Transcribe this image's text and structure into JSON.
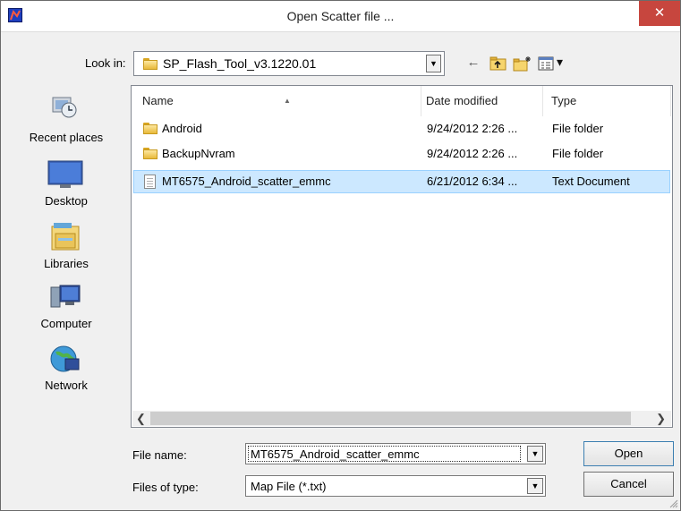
{
  "window": {
    "title": "Open Scatter file ...",
    "close_glyph": "✕"
  },
  "lookin": {
    "label": "Look in:",
    "value": "SP_Flash_Tool_v3.1220.01"
  },
  "toolbar": {
    "back_glyph": "←",
    "up_glyph": "↑",
    "new_glyph": "✱",
    "view_glyph": "▾"
  },
  "places": [
    {
      "label": "Recent places",
      "icon": "recent-places-icon"
    },
    {
      "label": "Desktop",
      "icon": "desktop-icon"
    },
    {
      "label": "Libraries",
      "icon": "libraries-icon"
    },
    {
      "label": "Computer",
      "icon": "computer-icon"
    },
    {
      "label": "Network",
      "icon": "network-icon"
    }
  ],
  "filelist": {
    "columns": [
      "Name",
      "Date modified",
      "Type"
    ],
    "rows": [
      {
        "name": "Android",
        "date": "9/24/2012 2:26 ...",
        "type": "File folder",
        "icon": "folder-icon"
      },
      {
        "name": "BackupNvram",
        "date": "9/24/2012 2:26 ...",
        "type": "File folder",
        "icon": "folder-icon"
      },
      {
        "name": "MT6575_Android_scatter_emmc",
        "date": "6/21/2012 6:34 ...",
        "type": "Text Document",
        "icon": "text-document-icon",
        "selected": true
      }
    ]
  },
  "filename": {
    "label": "File name:",
    "value": "MT6575_Android_scatter_emmc"
  },
  "filetype": {
    "label": "Files of type:",
    "value": "Map File (*.txt)"
  },
  "buttons": {
    "open": "Open",
    "cancel": "Cancel"
  },
  "colors": {
    "selection": "#cce8ff",
    "close": "#c7463e",
    "accent": "#1f3fbf"
  }
}
